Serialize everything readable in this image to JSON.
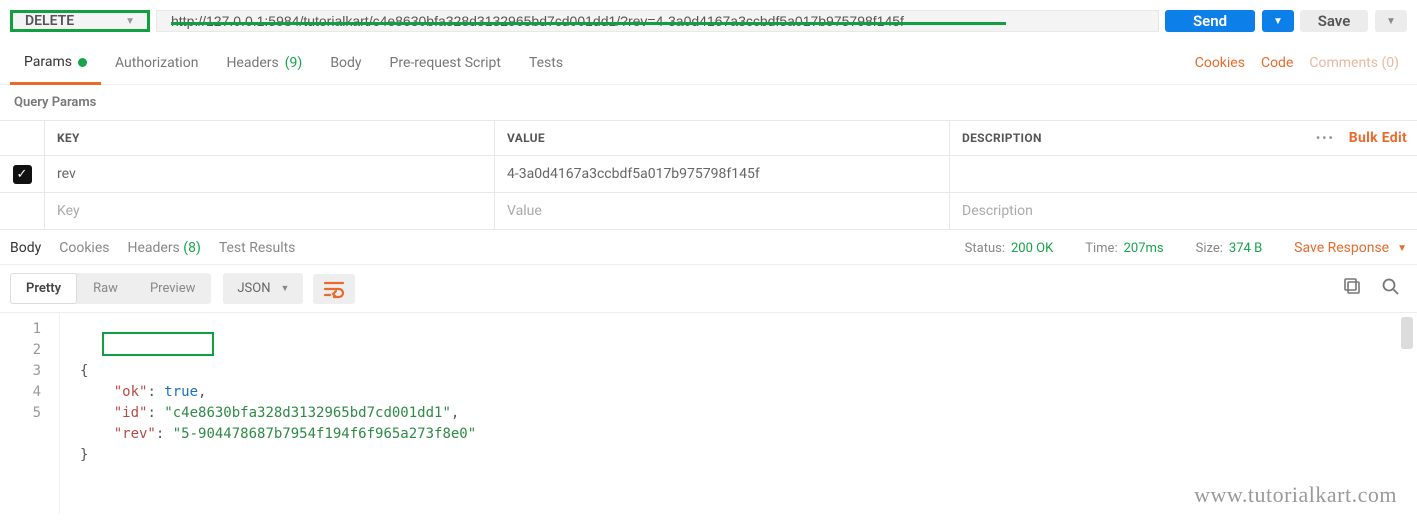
{
  "request": {
    "method": "DELETE",
    "url": "http://127.0.0.1:5984/tutorialkart/c4e8630bfa328d3132965bd7cd001dd1/?rev=4-3a0d4167a3ccbdf5a017b975798f145f",
    "send_label": "Send",
    "save_label": "Save"
  },
  "req_tabs": {
    "params": "Params",
    "authorization": "Authorization",
    "headers": "Headers",
    "headers_count": "(9)",
    "body": "Body",
    "prerequest": "Pre-request Script",
    "tests": "Tests",
    "cookies": "Cookies",
    "code": "Code",
    "comments": "Comments (0)"
  },
  "params_section": {
    "title": "Query Params",
    "head_key": "KEY",
    "head_value": "VALUE",
    "head_desc": "DESCRIPTION",
    "bulk_edit": "Bulk Edit",
    "rows": [
      {
        "key": "rev",
        "value": "4-3a0d4167a3ccbdf5a017b975798f145f",
        "desc": ""
      }
    ],
    "ph_key": "Key",
    "ph_value": "Value",
    "ph_desc": "Description"
  },
  "resp_tabs": {
    "body": "Body",
    "cookies": "Cookies",
    "headers": "Headers",
    "headers_count": "(8)",
    "test_results": "Test Results"
  },
  "resp_meta": {
    "status_label": "Status:",
    "status_value": "200 OK",
    "time_label": "Time:",
    "time_value": "207ms",
    "size_label": "Size:",
    "size_value": "374 B",
    "save_response": "Save Response"
  },
  "viewer": {
    "pretty": "Pretty",
    "raw": "Raw",
    "preview": "Preview",
    "lang": "JSON"
  },
  "response_body": {
    "line1": "{",
    "line2_key": "\"ok\"",
    "line2_val": "true",
    "line3_key": "\"id\"",
    "line3_val": "\"c4e8630bfa328d3132965bd7cd001dd1\"",
    "line4_key": "\"rev\"",
    "line4_val": "\"5-904478687b7954f194f6f965a273f8e0\"",
    "line5": "}"
  },
  "gutter": {
    "l1": "1",
    "l2": "2",
    "l3": "3",
    "l4": "4",
    "l5": "5"
  },
  "watermark": "www.tutorialkart.com"
}
